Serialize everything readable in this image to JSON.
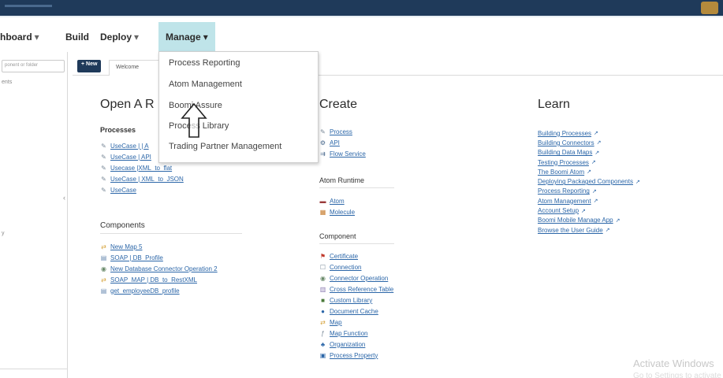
{
  "nav": {
    "dashboard": "hboard",
    "build": "Build",
    "deploy": "Deploy",
    "manage": "Manage",
    "caret": "▾"
  },
  "sidebar": {
    "search_placeholder": "ponent or folder",
    "tiny_top": "ents",
    "tiny_mid": "y",
    "collapse": "‹"
  },
  "tabbar": {
    "new_label": "+ New",
    "welcome_tab": "Welcome"
  },
  "open": {
    "title": "Open A R",
    "processes_title": "Processes",
    "processes": [
      "UseCase | | A",
      "UseCase | API",
      "Usecase |XML_to_flat",
      "UseCase | XML_to_JSON",
      "UseCase"
    ],
    "components_title": "Components",
    "components": [
      "New Map 5",
      "SOAP | DB_Profile",
      "New Database Connector Operation 2",
      "SOAP_MAP | DB_to_RestXML",
      "get_employeeDB_profile"
    ]
  },
  "create": {
    "title": "Create",
    "items": [
      "Process",
      "API",
      "Flow Service"
    ],
    "atom_runtime_title": "Atom Runtime",
    "runtime_items": [
      "Atom",
      "Molecule"
    ],
    "component_title": "Component",
    "component_items": [
      "Certificate",
      "Connection",
      "Connector Operation",
      "Cross Reference Table",
      "Custom Library",
      "Document Cache",
      "Map",
      "Map Function",
      "Organization",
      "Process Property"
    ]
  },
  "learn": {
    "title": "Learn",
    "items": [
      "Building Processes",
      "Building Connectors",
      "Building Data Maps",
      "Testing Processes",
      "The Boomi Atom",
      "Deploying Packaged Components",
      "Process Reporting",
      "Atom Management",
      "Account Setup",
      "Boomi Mobile Manage App",
      "Browse the User Guide"
    ],
    "ext_icon": "↗"
  },
  "manage_menu": {
    "items": [
      "Process Reporting",
      "Atom Management",
      "Boomi Assure",
      "Process Library",
      "Trading Partner Management"
    ]
  },
  "watermark": {
    "line1": "Activate Windows",
    "line2": "Go to Settings to activate"
  },
  "colors": {
    "topbar": "#1f3a5a",
    "manage_active": "#bfe4e9",
    "link": "#2b66a8"
  }
}
